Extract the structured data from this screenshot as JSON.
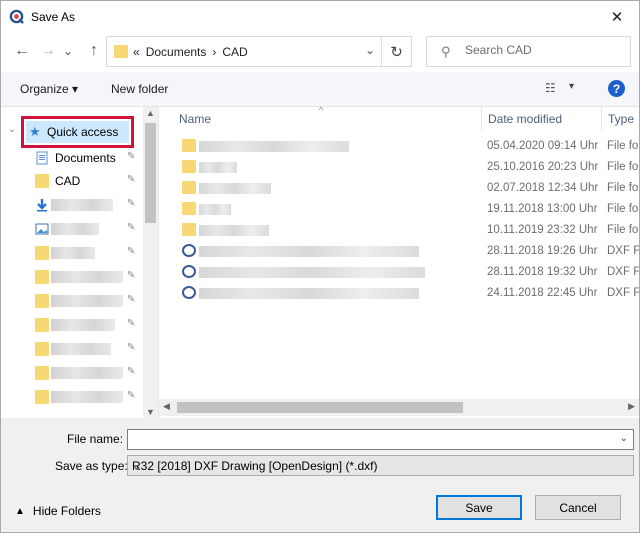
{
  "window": {
    "title": "Save As",
    "close_glyph": "✕"
  },
  "nav": {
    "back_glyph": "←",
    "forward_glyph": "→",
    "recent_glyph": "⌄",
    "up_glyph": "↑",
    "breadcrumb_prefix": "«",
    "breadcrumbs": [
      "Documents",
      "CAD"
    ],
    "breadcrumb_sep": "›",
    "address_drop_glyph": "⌄",
    "refresh_glyph": "↻",
    "search_placeholder": "Search CAD",
    "search_glyph": "⚲"
  },
  "toolbar": {
    "organize_label": "Organize ▾",
    "new_folder_label": "New folder",
    "view_glyph": "☷",
    "view_drop_glyph": "▾",
    "help_glyph": "?"
  },
  "sidebar": {
    "quick_access_label": "Quick access",
    "items": [
      {
        "label": "Documents",
        "icon": "documents-icon"
      },
      {
        "label": "CAD",
        "icon": "folder-icon"
      }
    ],
    "pin_glyph": "📌"
  },
  "columns": {
    "name": "Name",
    "date": "Date modified",
    "type": "Type"
  },
  "files": [
    {
      "date": "05.04.2020 09:14 Uhr",
      "type": "File fo",
      "icon": "folder"
    },
    {
      "date": "25.10.2016 20:23 Uhr",
      "type": "File fo",
      "icon": "folder"
    },
    {
      "date": "02.07.2018 12:34 Uhr",
      "type": "File fo",
      "icon": "folder"
    },
    {
      "date": "19.11.2018 13:00 Uhr",
      "type": "File fo",
      "icon": "folder"
    },
    {
      "date": "10.11.2019 23:32 Uhr",
      "type": "File fo",
      "icon": "folder"
    },
    {
      "date": "28.11.2018 19:26 Uhr",
      "type": "DXF Fi",
      "icon": "dxf"
    },
    {
      "date": "28.11.2018 19:32 Uhr",
      "type": "DXF Fi",
      "icon": "dxf"
    },
    {
      "date": "24.11.2018 22:45 Uhr",
      "type": "DXF Fi",
      "icon": "dxf"
    }
  ],
  "form": {
    "file_name_label": "File name:",
    "file_name_value": "",
    "save_type_label": "Save as type:",
    "save_type_value": "R32 [2018] DXF Drawing [OpenDesign] (*.dxf)",
    "hide_folders_label": "Hide Folders",
    "save_label": "Save",
    "cancel_label": "Cancel"
  }
}
